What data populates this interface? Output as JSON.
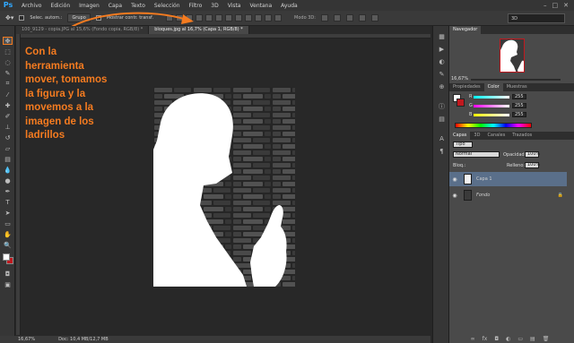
{
  "app": {
    "logo": "Ps"
  },
  "menu": [
    "Archivo",
    "Edición",
    "Imagen",
    "Capa",
    "Texto",
    "Selección",
    "Filtro",
    "3D",
    "Vista",
    "Ventana",
    "Ayuda"
  ],
  "window_controls": [
    "–",
    "□",
    "✕"
  ],
  "options": {
    "auto_select_label": "Selec. autom.:",
    "auto_select_value": "Grupo",
    "show_transform_label": "Mostrar contr. transf.",
    "mode_3d_label": "Modo 3D:",
    "workspace": "3D"
  },
  "tabs": [
    {
      "label": "100_9129 - copia.JPG al 15,6% (Fondo copia, RGB/8) *",
      "active": false
    },
    {
      "label": "bloques.jpg al 16,7% (Capa 1, RGB/8) *",
      "active": true
    }
  ],
  "overlay_text": [
    "Con la",
    "herramienta",
    "mover, tomamos",
    "la figura y la",
    "movemos a la",
    "imagen de los",
    "ladrillos"
  ],
  "status": {
    "zoom": "16,67%",
    "doc": "Doc: 10,4 MB/12,7 MB"
  },
  "panels": {
    "navigator": {
      "tab": "Navegador",
      "zoom": "16,67%"
    },
    "properties_tab": "Propiedades",
    "color_tab": "Color",
    "swatches_tab": "Muestras",
    "color_values": {
      "R": "255",
      "G": "255",
      "B": "255"
    },
    "layers_tabs": [
      "Capas",
      "3D",
      "Canales",
      "Trazados"
    ],
    "kind_filter": "Tipo",
    "blend_mode": "Normal",
    "opacity_label": "Opacidad:",
    "opacity_value": "100%",
    "lock_label": "Bloq.:",
    "fill_label": "Relleno:",
    "fill_value": "100%",
    "layers": [
      {
        "name": "Capa 1",
        "selected": true
      },
      {
        "name": "Fondo",
        "selected": false
      }
    ]
  },
  "colors": {
    "accent": "#f47b20",
    "background_swatch": "#c0191f",
    "selection": "#5a6f8a"
  }
}
